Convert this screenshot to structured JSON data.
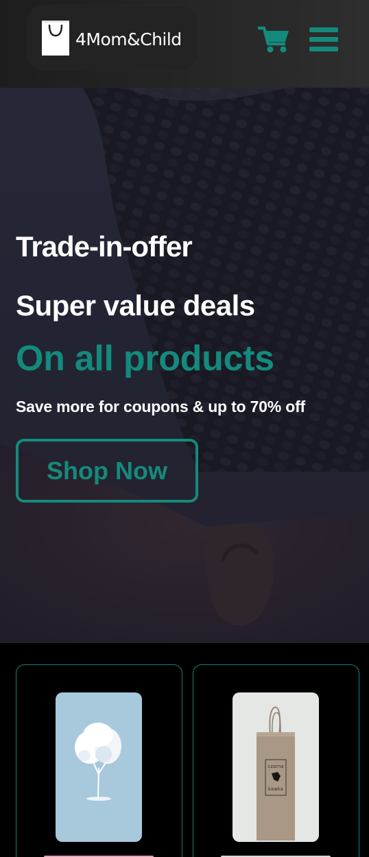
{
  "header": {
    "brand": "4Mom&Child",
    "logo_icon": "shopping-bag-icon",
    "cart_icon": "shopping-cart-icon",
    "menu_icon": "hamburger-menu-icon"
  },
  "hero": {
    "line1": "Trade-in-offer",
    "line2": "Super value deals",
    "line3": "On all products",
    "line4": "Save more for coupons & up to 70% off",
    "button_label": "Shop Now"
  },
  "products": [
    {
      "image": "blue tree illustration"
    },
    {
      "image": "paper bag",
      "bag_text_1": "czarna",
      "bag_text_2": "kawka"
    }
  ],
  "colors": {
    "accent": "#148a7d",
    "header_bg": "#262626",
    "page_bg": "#000000",
    "text": "#ffffff"
  }
}
